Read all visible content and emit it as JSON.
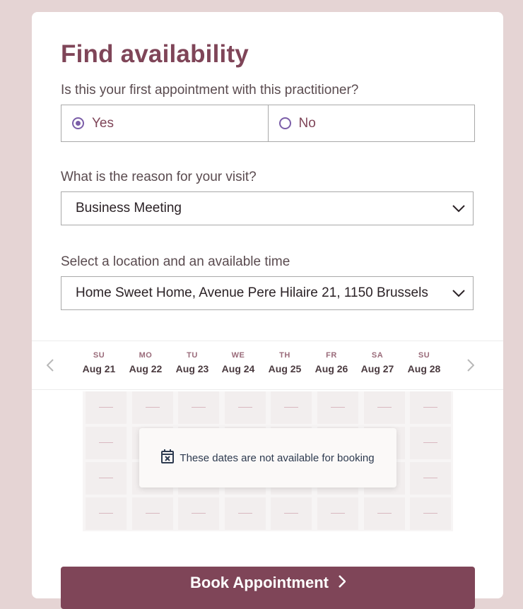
{
  "title": "Find availability",
  "first_appointment": {
    "question": "Is this your first appointment with this practitioner?",
    "options": [
      {
        "label": "Yes",
        "selected": true
      },
      {
        "label": "No",
        "selected": false
      }
    ]
  },
  "reason": {
    "label": "What is the reason for your visit?",
    "value": "Business Meeting"
  },
  "location": {
    "label": "Select a location and an available time",
    "value": "Home Sweet Home, Avenue Pere Hilaire 21, 1150 Brussels"
  },
  "dates": [
    {
      "dow": "SU",
      "date": "Aug 21"
    },
    {
      "dow": "MO",
      "date": "Aug 22"
    },
    {
      "dow": "TU",
      "date": "Aug 23"
    },
    {
      "dow": "WE",
      "date": "Aug 24"
    },
    {
      "dow": "TH",
      "date": "Aug 25"
    },
    {
      "dow": "FR",
      "date": "Aug 26"
    },
    {
      "dow": "SA",
      "date": "Aug 27"
    },
    {
      "dow": "SU",
      "date": "Aug 28"
    }
  ],
  "unavailable_notice": "These dates are not available for booking",
  "book_button": "Book Appointment",
  "icons": {
    "prev": "chevron-left-icon",
    "next": "chevron-right-icon",
    "calendar": "calendar-x-icon",
    "dropdown": "chevron-down-icon"
  },
  "colors": {
    "brand": "#7f4558",
    "radio": "#7b5ea8",
    "background": "#e5d4d4"
  }
}
